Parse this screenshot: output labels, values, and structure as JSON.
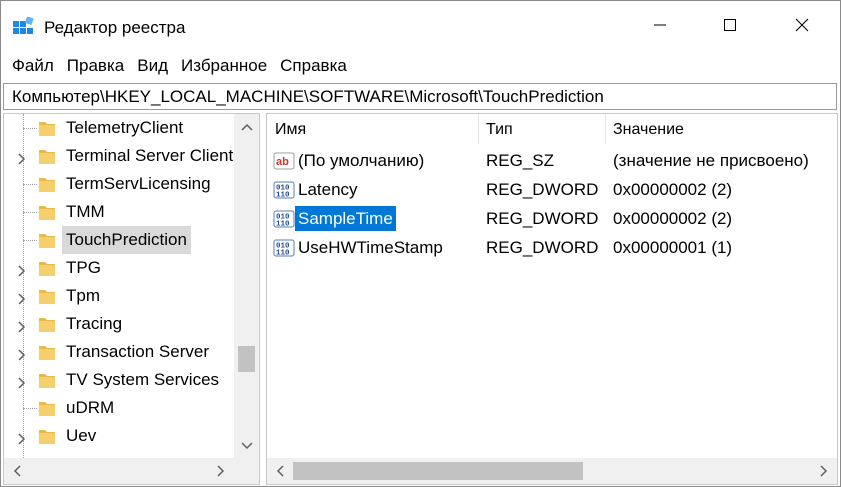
{
  "window": {
    "title": "Редактор реестра"
  },
  "menu": [
    "Файл",
    "Правка",
    "Вид",
    "Избранное",
    "Справка"
  ],
  "address": "Компьютер\\HKEY_LOCAL_MACHINE\\SOFTWARE\\Microsoft\\TouchPrediction",
  "tree": {
    "items": [
      {
        "label": "TelemetryClient",
        "expandable": false,
        "selected": false
      },
      {
        "label": "Terminal Server Client",
        "expandable": true,
        "selected": false
      },
      {
        "label": "TermServLicensing",
        "expandable": false,
        "selected": false
      },
      {
        "label": "TMM",
        "expandable": false,
        "selected": false
      },
      {
        "label": "TouchPrediction",
        "expandable": false,
        "selected": true
      },
      {
        "label": "TPG",
        "expandable": true,
        "selected": false
      },
      {
        "label": "Tpm",
        "expandable": true,
        "selected": false
      },
      {
        "label": "Tracing",
        "expandable": true,
        "selected": false
      },
      {
        "label": "Transaction Server",
        "expandable": true,
        "selected": false
      },
      {
        "label": "TV System Services",
        "expandable": true,
        "selected": false
      },
      {
        "label": "uDRM",
        "expandable": false,
        "selected": false
      },
      {
        "label": "Uev",
        "expandable": true,
        "selected": false
      }
    ]
  },
  "list": {
    "columns": [
      "Имя",
      "Тип",
      "Значение"
    ],
    "rows": [
      {
        "name": "(По умолчанию)",
        "type": "REG_SZ",
        "data": "(значение не присвоено)",
        "icon": "string-value-icon",
        "selected": false
      },
      {
        "name": "Latency",
        "type": "REG_DWORD",
        "data": "0x00000002 (2)",
        "icon": "binary-value-icon",
        "selected": false
      },
      {
        "name": "SampleTime",
        "type": "REG_DWORD",
        "data": "0x00000002 (2)",
        "icon": "binary-value-icon",
        "selected": true
      },
      {
        "name": "UseHWTimeStamp",
        "type": "REG_DWORD",
        "data": "0x00000001 (1)",
        "icon": "binary-value-icon",
        "selected": false
      }
    ]
  },
  "colors": {
    "selection": "#0078d7",
    "tree_selection": "#d9d9d9",
    "folder": "#e8b84a",
    "scrollbar": "#f0f0f0"
  }
}
